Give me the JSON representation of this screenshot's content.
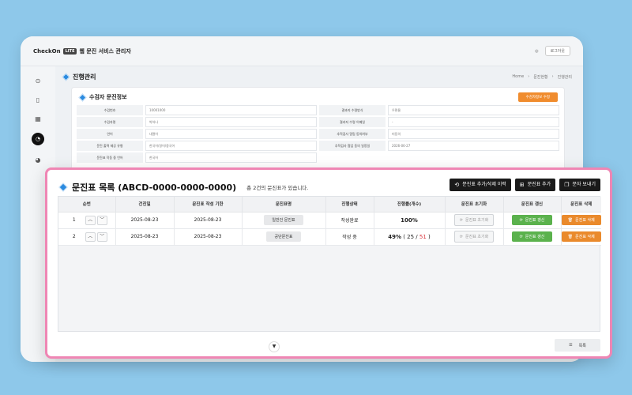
{
  "app": {
    "brand": "CheckOn",
    "brand_tag": "LITE",
    "title": "웹 문진 서비스 관리자",
    "logout": "로그아웃"
  },
  "breadcrumb": [
    "Home",
    "문진현황",
    "진행관리"
  ],
  "page_title": "진행관리",
  "info_card": {
    "title": "수검자 문진정보",
    "action_button": "수검자정보 수정",
    "rows": [
      {
        "label": "수검번호",
        "value": "10001000",
        "label2": "결과지 수령방식",
        "value2": "우편물"
      },
      {
        "label": "수검자명",
        "value": "박하나",
        "label2": "결과지 수령 이메일",
        "value2": "-"
      },
      {
        "label": "언어",
        "value": "내열어",
        "label2": "추적검사 알림 동의여부",
        "value2": "미동의"
      },
      {
        "label": "문진 출력 제공 유형",
        "value": "한국어/영어/중국어",
        "label2": "추적검사 협업 동의 일정일",
        "value2": "2026-06-27"
      },
      {
        "label": "문진표 작동 중 언어",
        "value": "한국어",
        "label2": "",
        "value2": ""
      }
    ]
  },
  "modal": {
    "title": "문진표 목록 (ABCD-0000-0000-0000)",
    "subtitle": "총 2건의 문진표가 있습니다.",
    "actions": [
      "문진표 추가/삭제 이력",
      "문진표 추가",
      "문자 보내기"
    ],
    "columns": [
      "순번",
      "건진일",
      "문진표 작성 기한",
      "문진표명",
      "진행상태",
      "진행률(개수)",
      "문진표 초기화",
      "문진표 갱신",
      "문진표 삭제"
    ],
    "rows": [
      {
        "no": "1",
        "exam_date": "2025-08-23",
        "deadline": "2025-08-23",
        "name": "일반건 문진표",
        "status": "작성완료",
        "progress": "100%",
        "progress_done": "",
        "progress_total": "",
        "reset": "문진표 초기화",
        "refresh": "문진표 갱신",
        "delete": "문진표 삭제"
      },
      {
        "no": "2",
        "exam_date": "2025-08-23",
        "deadline": "2025-08-23",
        "name": "공단문진표",
        "status": "작성 중",
        "progress": "49%",
        "progress_done": "25",
        "progress_total": "51",
        "reset": "문진표 초기화",
        "refresh": "문진표 갱신",
        "delete": "문진표 삭제"
      }
    ],
    "list_button": "목록"
  },
  "colors": {
    "accent_blue": "#2b8be0",
    "modal_border": "#ef86b4",
    "green": "#5bb24d",
    "orange": "#ea8a2c",
    "background": "#8ec8ea"
  }
}
